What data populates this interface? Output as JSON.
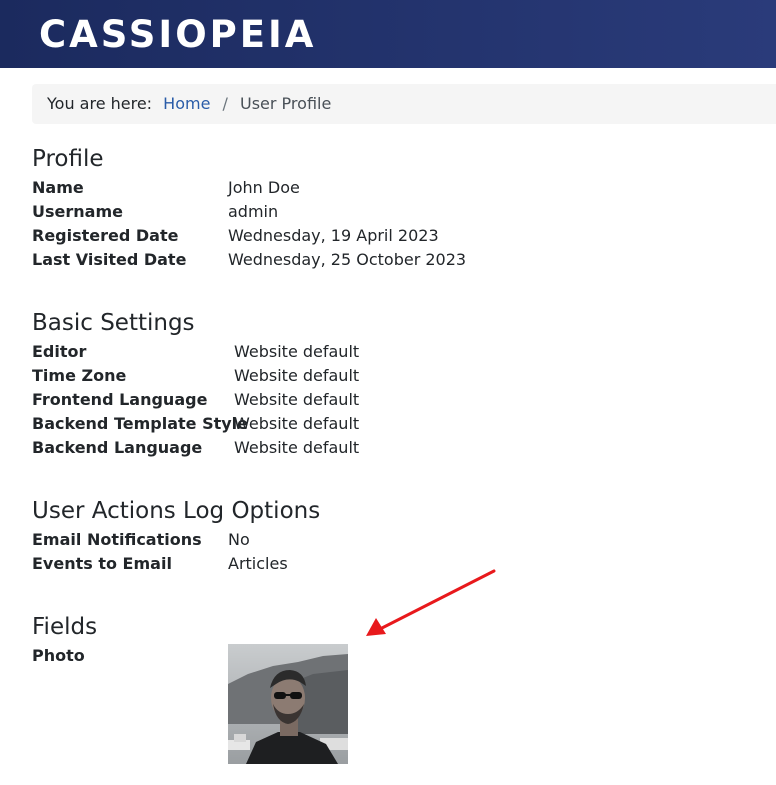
{
  "header": {
    "brand": "CASSIOPEIA"
  },
  "breadcrumb": {
    "prefix": "You are here:",
    "home": "Home",
    "separator": "/",
    "current": "User Profile"
  },
  "profile": {
    "title": "Profile",
    "rows": [
      {
        "label": "Name",
        "value": "John Doe"
      },
      {
        "label": "Username",
        "value": "admin"
      },
      {
        "label": "Registered Date",
        "value": "Wednesday, 19 April 2023"
      },
      {
        "label": "Last Visited Date",
        "value": "Wednesday, 25 October 2023"
      }
    ]
  },
  "basic_settings": {
    "title": "Basic Settings",
    "rows": [
      {
        "label": "Editor",
        "value": "Website default"
      },
      {
        "label": "Time Zone",
        "value": "Website default"
      },
      {
        "label": "Frontend Language",
        "value": "Website default"
      },
      {
        "label": "Backend Template Style",
        "value": "Website default"
      },
      {
        "label": "Backend Language",
        "value": "Website default"
      }
    ]
  },
  "actions_log": {
    "title": "User Actions Log Options",
    "rows": [
      {
        "label": "Email Notifications",
        "value": "No"
      },
      {
        "label": "Events to Email",
        "value": "Articles"
      }
    ]
  },
  "fields": {
    "title": "Fields",
    "photo_label": "Photo"
  },
  "colors": {
    "header_bg": "#1f2f6a",
    "link": "#2a5ca8",
    "annotation_arrow": "#e8191c"
  }
}
